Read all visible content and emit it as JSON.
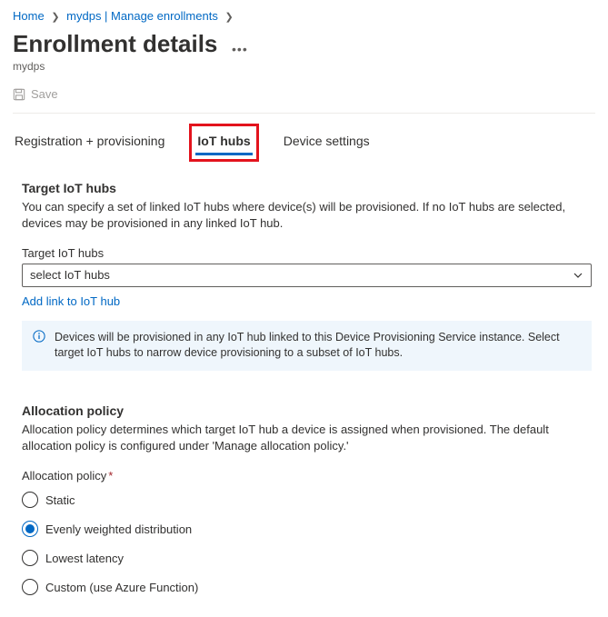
{
  "breadcrumb": {
    "home": "Home",
    "item2": "mydps | Manage enrollments"
  },
  "page": {
    "title": "Enrollment details",
    "subtitle": "mydps"
  },
  "toolbar": {
    "save_label": "Save"
  },
  "tabs": {
    "reg": "Registration + provisioning",
    "iot": "IoT hubs",
    "device": "Device settings"
  },
  "target_section": {
    "heading": "Target IoT hubs",
    "description": "You can specify a set of linked IoT hubs where device(s) will be provisioned. If no IoT hubs are selected, devices may be provisioned in any linked IoT hub.",
    "field_label": "Target IoT hubs",
    "dropdown_value": "select IoT hubs",
    "add_link": "Add link to IoT hub",
    "info_text": "Devices will be provisioned in any IoT hub linked to this Device Provisioning Service instance. Select target IoT hubs to narrow device provisioning to a subset of IoT hubs."
  },
  "allocation_section": {
    "heading": "Allocation policy",
    "description": "Allocation policy determines which target IoT hub a device is assigned when provisioned. The default allocation policy is configured under 'Manage allocation policy.'",
    "field_label": "Allocation policy",
    "options": {
      "static": "Static",
      "even": "Evenly weighted distribution",
      "lowest": "Lowest latency",
      "custom": "Custom (use Azure Function)"
    },
    "selected": "even"
  }
}
